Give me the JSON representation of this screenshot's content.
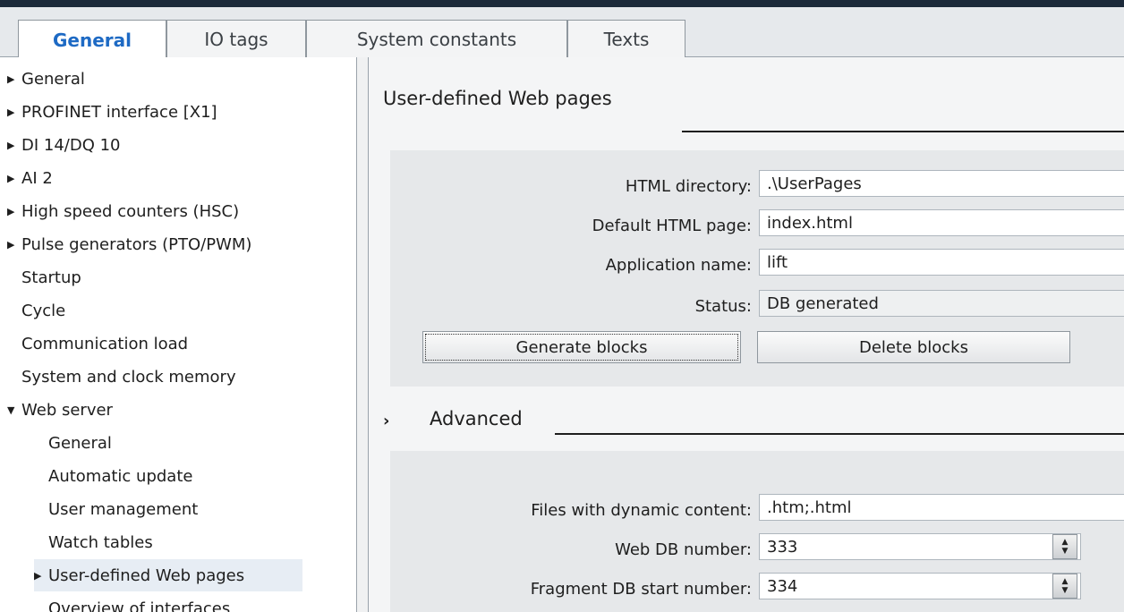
{
  "tabs": [
    {
      "label": "General",
      "active": true
    },
    {
      "label": "IO tags",
      "active": false
    },
    {
      "label": "System constants",
      "active": false
    },
    {
      "label": "Texts",
      "active": false
    }
  ],
  "nav": {
    "items": [
      {
        "label": "General",
        "arrow": "collapsed"
      },
      {
        "label": "PROFINET interface [X1]",
        "arrow": "collapsed"
      },
      {
        "label": "DI 14/DQ 10",
        "arrow": "collapsed"
      },
      {
        "label": "AI 2",
        "arrow": "collapsed"
      },
      {
        "label": "High speed counters (HSC)",
        "arrow": "collapsed"
      },
      {
        "label": "Pulse generators (PTO/PWM)",
        "arrow": "collapsed"
      },
      {
        "label": "Startup",
        "arrow": "none"
      },
      {
        "label": "Cycle",
        "arrow": "none"
      },
      {
        "label": "Communication load",
        "arrow": "none"
      },
      {
        "label": "System and clock memory",
        "arrow": "none"
      },
      {
        "label": "Web server",
        "arrow": "expanded"
      },
      {
        "label": "General",
        "arrow": "none"
      },
      {
        "label": "Automatic update",
        "arrow": "none"
      },
      {
        "label": "User management",
        "arrow": "none"
      },
      {
        "label": "Watch tables",
        "arrow": "none"
      },
      {
        "label": "User-defined Web pages",
        "arrow": "collapsed",
        "selected": true
      },
      {
        "label": "Overview of interfaces",
        "arrow": "none"
      }
    ]
  },
  "user_pages": {
    "title": "User-defined Web pages",
    "html_directory_label": "HTML directory:",
    "html_directory_value": ".\\UserPages",
    "default_page_label": "Default HTML page:",
    "default_page_value": "index.html",
    "app_name_label": "Application name:",
    "app_name_value": "lift",
    "status_label": "Status:",
    "status_value": "DB generated",
    "generate_button": "Generate blocks",
    "delete_button": "Delete blocks"
  },
  "advanced": {
    "chevron": "›",
    "title": "Advanced",
    "dynamic_label": "Files with dynamic content:",
    "dynamic_value": ".htm;.html",
    "web_db_label": "Web DB number:",
    "web_db_value": "333",
    "fragment_db_label": "Fragment DB start number:",
    "fragment_db_value": "334"
  },
  "icons": {
    "expanded_arrow": "▼",
    "collapsed_arrow": "▶",
    "spin_up": "▲",
    "spin_down": "▼"
  }
}
